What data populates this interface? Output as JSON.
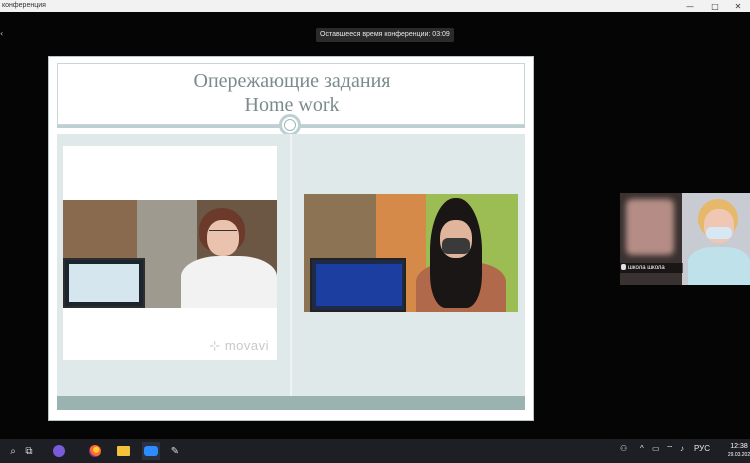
{
  "window": {
    "title": "конференция",
    "controls": [
      "minimize",
      "maximize",
      "close"
    ]
  },
  "meeting": {
    "time_remaining_label": "Оставшееся время конференции: 03:09"
  },
  "slide": {
    "title_ru": "Опережающие задания",
    "title_en": "Home work",
    "watermark": "movavi"
  },
  "participants": [
    {
      "name": "школа школа"
    }
  ],
  "taskbar": {
    "icons": [
      "windows-icon",
      "search-icon",
      "task-view-icon",
      "cortana-icon",
      "firefox-icon",
      "file-explorer-icon",
      "zoom-icon",
      "app-icon"
    ],
    "language": "РУС",
    "time": "12:38",
    "date": "29.03.202"
  },
  "colors": {
    "accent_slide": "#bcd0d3",
    "bottom_band": "#9ab3b1",
    "zoom_blue": "#2d8cff"
  }
}
